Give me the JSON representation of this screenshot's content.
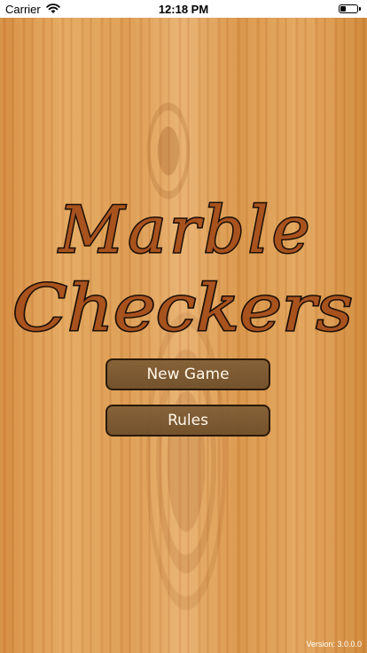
{
  "status_bar": {
    "carrier": "Carrier",
    "time": "12:18 PM",
    "wifi_icon": "wifi-icon",
    "battery_icon": "battery-icon",
    "battery_level": 0.3
  },
  "title": {
    "line1": "Marble",
    "line2": "Checkers"
  },
  "menu": {
    "new_game_label": "New Game",
    "rules_label": "Rules"
  },
  "version_text": "Version: 3.0.0.0",
  "colors": {
    "wood_base": "#d99a4e",
    "title_fill": "#a8521e",
    "title_outline": "#1a0e05",
    "button_bg": "#7a5730",
    "button_border": "#2a1a08",
    "button_text": "#fff8ea"
  }
}
